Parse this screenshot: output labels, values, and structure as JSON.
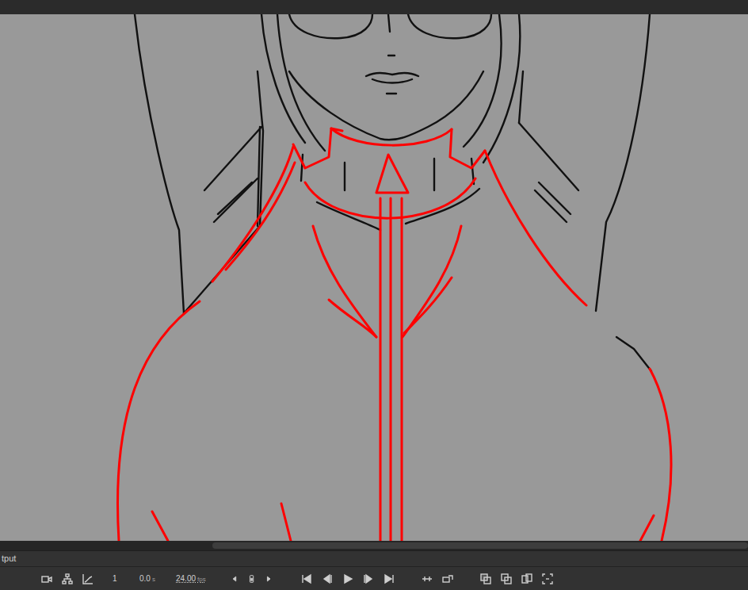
{
  "panel": {
    "title": "tput"
  },
  "timeline": {
    "frame": "1",
    "time_value": "0.0",
    "time_unit": "s",
    "fps_value": "24.00",
    "fps_unit": "fps"
  }
}
